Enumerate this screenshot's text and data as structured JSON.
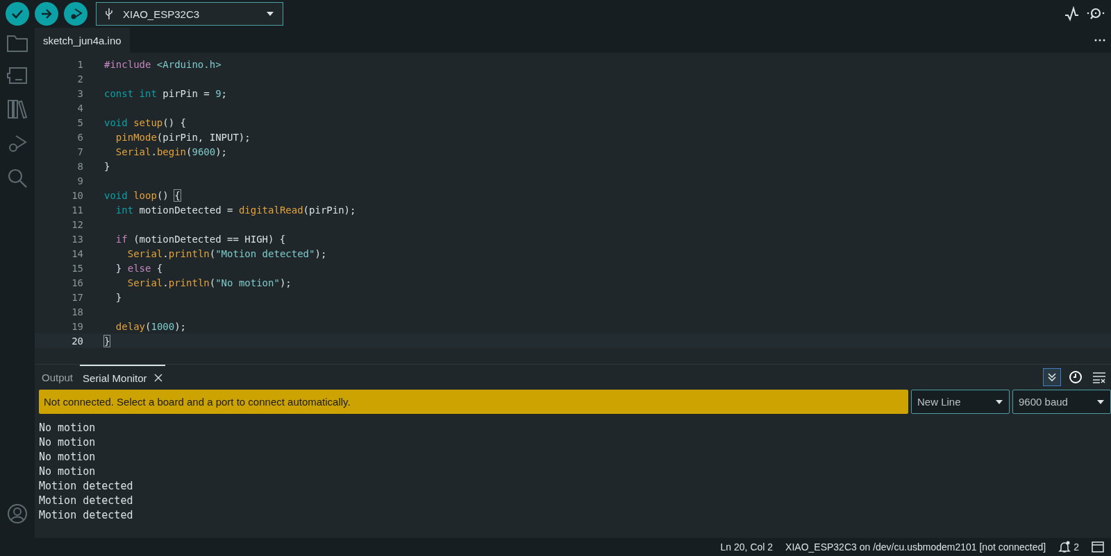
{
  "toolbar": {
    "board": "XIAO_ESP32C3"
  },
  "editor": {
    "tabs": [
      {
        "label": "sketch_jun4a.ino",
        "selected": true
      }
    ],
    "lines": [
      {
        "number": "1",
        "current": false,
        "tokens": [
          {
            "t": "#include ",
            "kind": "keyword"
          },
          {
            "t": "<Arduino.h>",
            "kind": "literal"
          }
        ]
      },
      {
        "number": "2",
        "current": false
      },
      {
        "number": "3",
        "current": false,
        "tokens": [
          {
            "t": "const ",
            "kind": "type"
          },
          {
            "t": "int",
            "kind": "type"
          },
          {
            "t": " pirPin = "
          },
          {
            "t": "9",
            "kind": "literal"
          },
          {
            "t": ";"
          }
        ]
      },
      {
        "number": "4",
        "current": false
      },
      {
        "number": "5",
        "current": false,
        "tokens": [
          {
            "t": "void ",
            "kind": "type"
          },
          {
            "t": "setup",
            "kind": "func"
          },
          {
            "t": "() {"
          }
        ]
      },
      {
        "number": "6",
        "current": false,
        "tokens": [
          {
            "t": "  pinMode",
            "kind": "func"
          },
          {
            "t": "(pirPin, INPUT);"
          }
        ]
      },
      {
        "number": "7",
        "current": false,
        "tokens": [
          {
            "t": "  Serial",
            "kind": "func"
          },
          {
            "t": "."
          },
          {
            "t": "begin",
            "kind": "func"
          },
          {
            "t": "("
          },
          {
            "t": "9600",
            "kind": "literal"
          },
          {
            "t": ");"
          }
        ]
      },
      {
        "number": "8",
        "current": false,
        "tokens": [
          {
            "t": "}"
          }
        ]
      },
      {
        "number": "9",
        "current": false
      },
      {
        "number": "10",
        "current": false,
        "tokens": [
          {
            "t": "void ",
            "kind": "type"
          },
          {
            "t": "loop",
            "kind": "func"
          },
          {
            "t": "() "
          },
          {
            "t": "{",
            "kind": "match"
          }
        ]
      },
      {
        "number": "11",
        "current": false,
        "tokens": [
          {
            "t": "  int",
            "kind": "type"
          },
          {
            "t": " motionDetected = "
          },
          {
            "t": "digitalRead",
            "kind": "func"
          },
          {
            "t": "(pirPin);"
          }
        ]
      },
      {
        "number": "12",
        "current": false
      },
      {
        "number": "13",
        "current": false,
        "tokens": [
          {
            "t": "  if",
            "kind": "keyword"
          },
          {
            "t": " (motionDetected == HIGH) {"
          }
        ]
      },
      {
        "number": "14",
        "current": false,
        "tokens": [
          {
            "t": "    Serial",
            "kind": "func"
          },
          {
            "t": "."
          },
          {
            "t": "println",
            "kind": "func"
          },
          {
            "t": "("
          },
          {
            "t": "\"Motion detected\"",
            "kind": "literal"
          },
          {
            "t": ");"
          }
        ]
      },
      {
        "number": "15",
        "current": false,
        "tokens": [
          {
            "t": "  } "
          },
          {
            "t": "else",
            "kind": "keyword"
          },
          {
            "t": " {"
          }
        ]
      },
      {
        "number": "16",
        "current": false,
        "tokens": [
          {
            "t": "    Serial",
            "kind": "func"
          },
          {
            "t": "."
          },
          {
            "t": "println",
            "kind": "func"
          },
          {
            "t": "("
          },
          {
            "t": "\"No motion\"",
            "kind": "literal"
          },
          {
            "t": ");"
          }
        ]
      },
      {
        "number": "17",
        "current": false,
        "tokens": [
          {
            "t": "  }"
          }
        ]
      },
      {
        "number": "18",
        "current": false
      },
      {
        "number": "19",
        "current": false,
        "tokens": [
          {
            "t": "  delay",
            "kind": "func"
          },
          {
            "t": "("
          },
          {
            "t": "1000",
            "kind": "literal"
          },
          {
            "t": ");"
          }
        ]
      },
      {
        "number": "20",
        "current": true,
        "tokens": [
          {
            "t": "}",
            "kind": "match"
          }
        ]
      }
    ]
  },
  "panel": {
    "tabs": [
      {
        "label": "Output",
        "selected": false,
        "closable": false
      },
      {
        "label": "Serial Monitor",
        "selected": true,
        "closable": true
      }
    ],
    "autoscroll": {
      "on": true
    },
    "message": "Not connected. Select a board and a port to connect automatically.",
    "line_ending": "New Line",
    "baud": "9600 baud",
    "output": [
      "No motion",
      "No motion",
      "No motion",
      "No motion",
      "Motion detected",
      "Motion detected",
      "Motion detected"
    ]
  },
  "status_bar": {
    "position": "Ln 20, Col 2",
    "board": "XIAO_ESP32C3 on /dev/cu.usbmodem2101 [not connected]",
    "notifications": "2"
  }
}
